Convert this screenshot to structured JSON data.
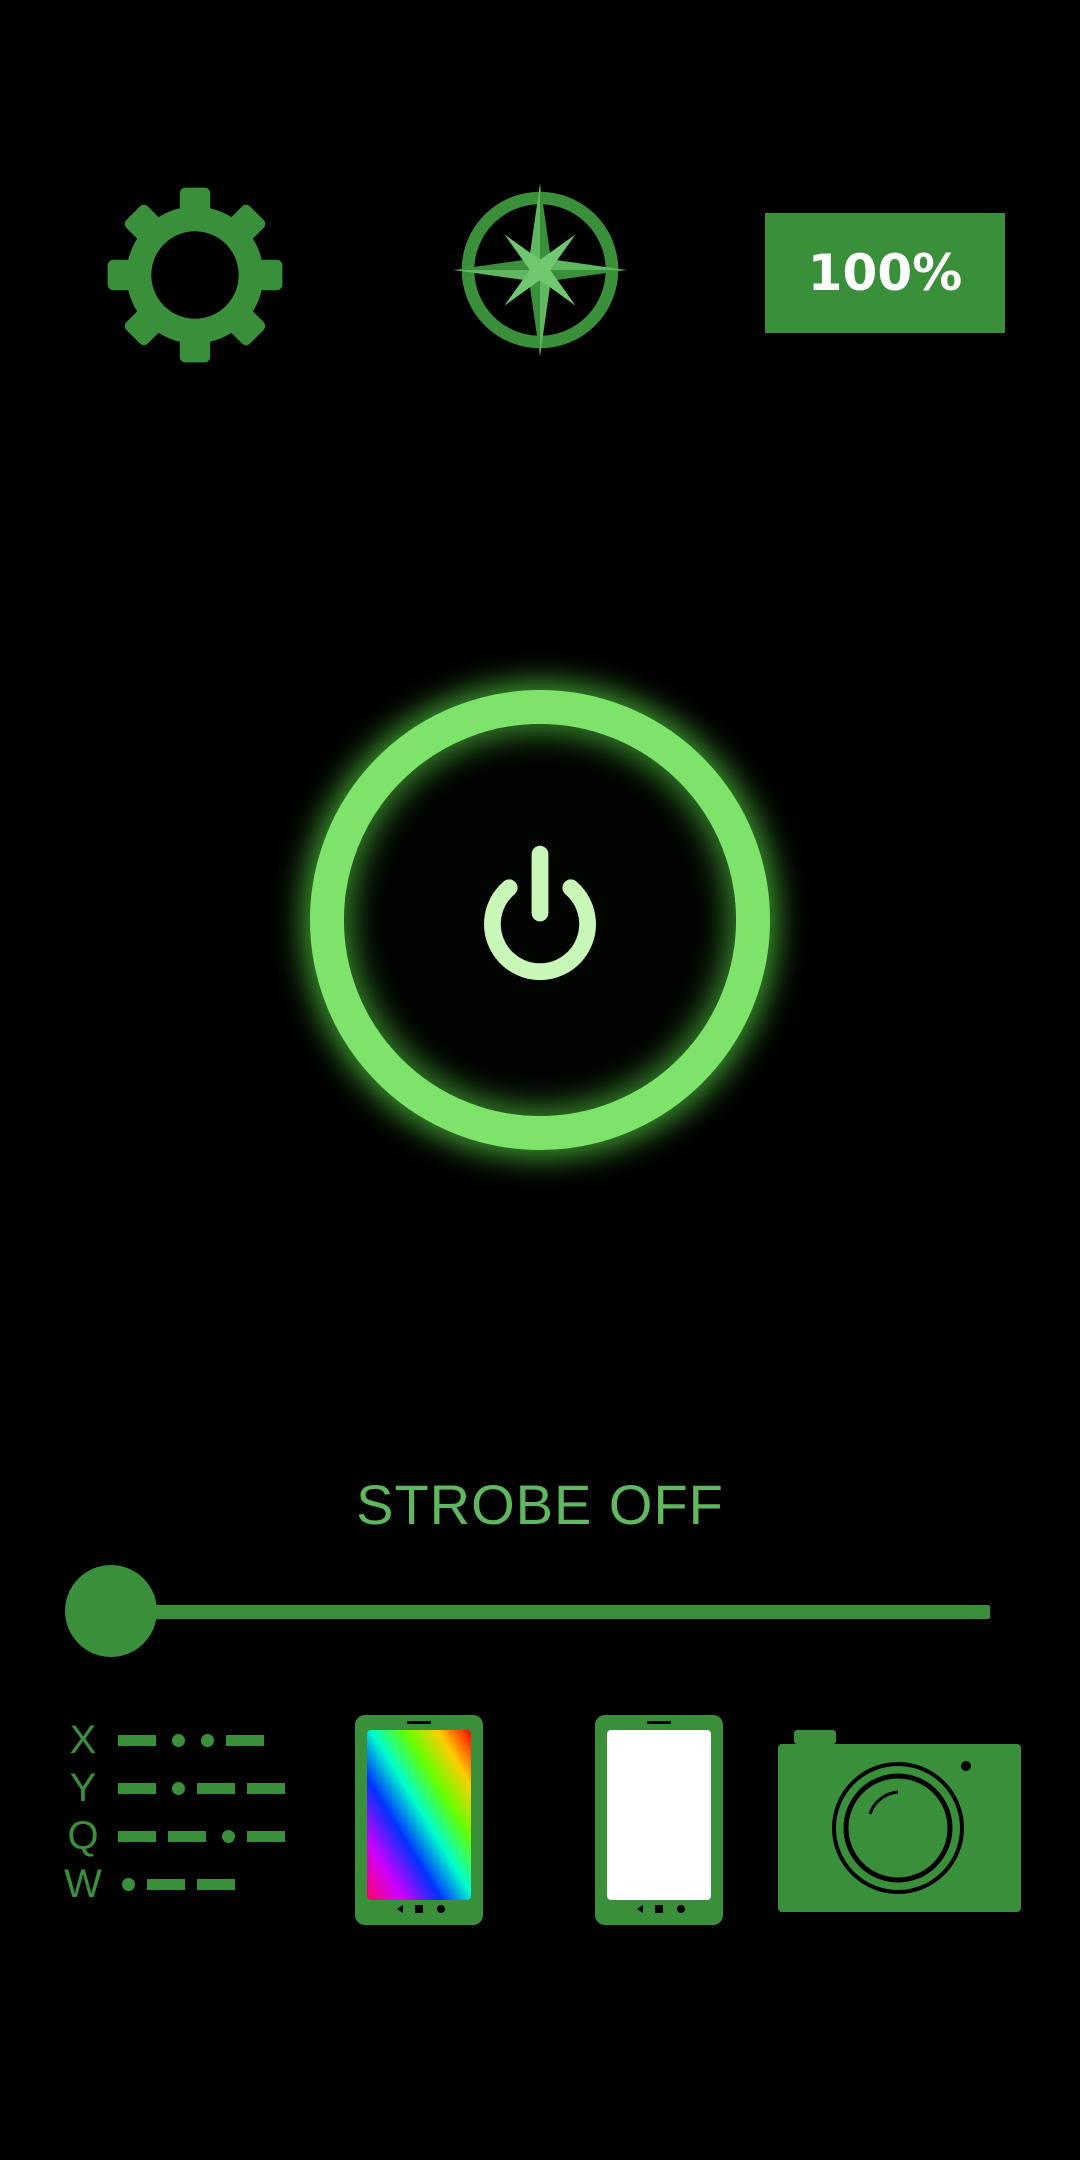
{
  "topbar": {
    "battery_label": "100%",
    "settings_icon": "gear-icon",
    "compass_icon": "compass-icon"
  },
  "power": {
    "icon": "power-icon",
    "state": "off"
  },
  "strobe": {
    "label": "STROBE OFF",
    "level": 0
  },
  "morse": {
    "rows": [
      {
        "letter": "X",
        "code": "-..-"
      },
      {
        "letter": "Y",
        "code": "-.--"
      },
      {
        "letter": "Q",
        "code": "--.-"
      },
      {
        "letter": "W",
        "code": ".--"
      }
    ]
  },
  "bottom_icons": [
    "morse-code-icon",
    "color-screen-icon",
    "white-screen-icon",
    "camera-icon"
  ],
  "colors": {
    "accent": "#3a8f3a",
    "glow": "#7de36b",
    "background": "#000000",
    "label": "#5fb85f"
  }
}
